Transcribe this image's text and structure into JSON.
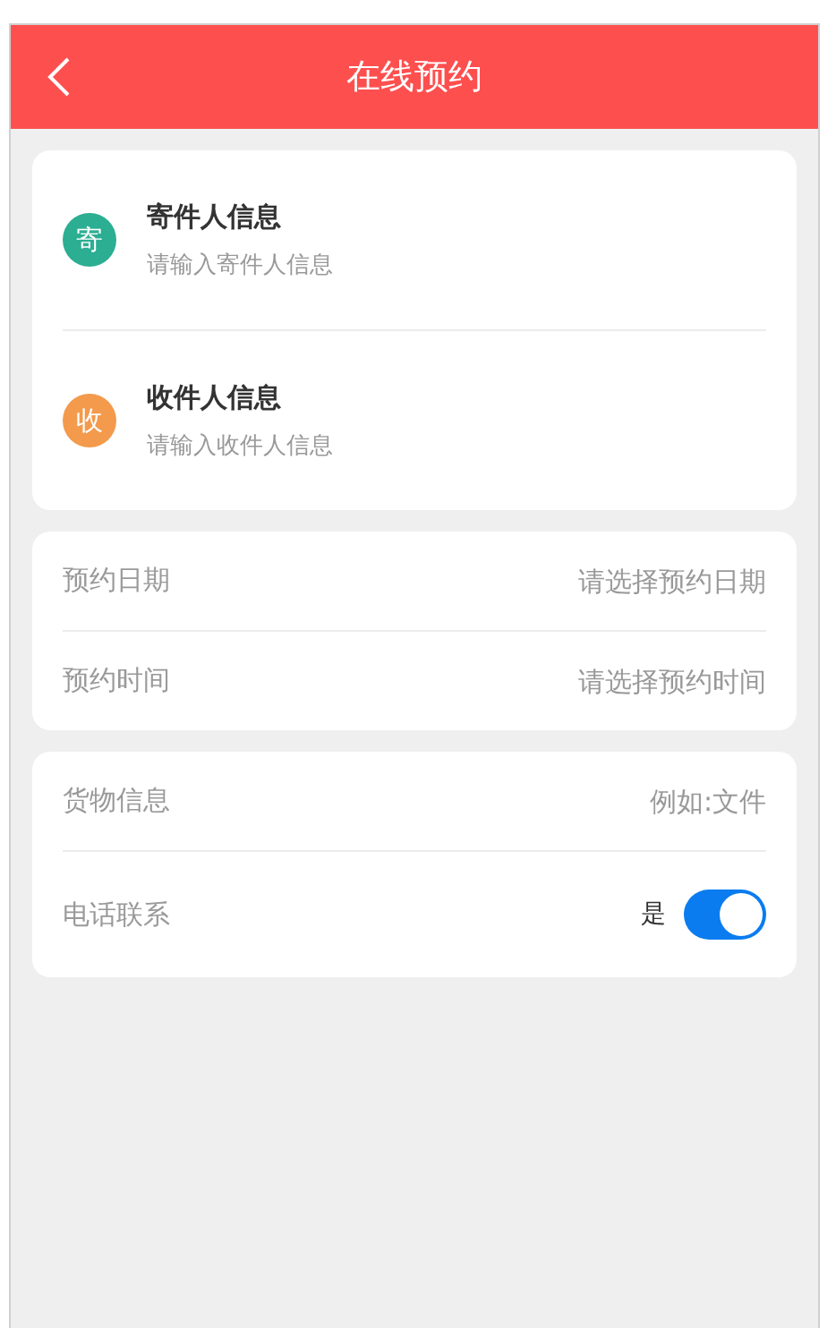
{
  "header": {
    "title": "在线预约"
  },
  "contacts": [
    {
      "badge": "寄",
      "title": "寄件人信息",
      "placeholder": "请输入寄件人信息",
      "color": "#2bae92"
    },
    {
      "badge": "收",
      "title": "收件人信息",
      "placeholder": "请输入收件人信息",
      "color": "#f39a4c"
    }
  ],
  "schedule": [
    {
      "label": "预约日期",
      "placeholder": "请选择预约日期"
    },
    {
      "label": "预约时间",
      "placeholder": "请选择预约时间"
    }
  ],
  "goods": {
    "label": "货物信息",
    "placeholder": "例如:文件"
  },
  "phone": {
    "label": "电话联系",
    "value": "是",
    "on": true
  }
}
